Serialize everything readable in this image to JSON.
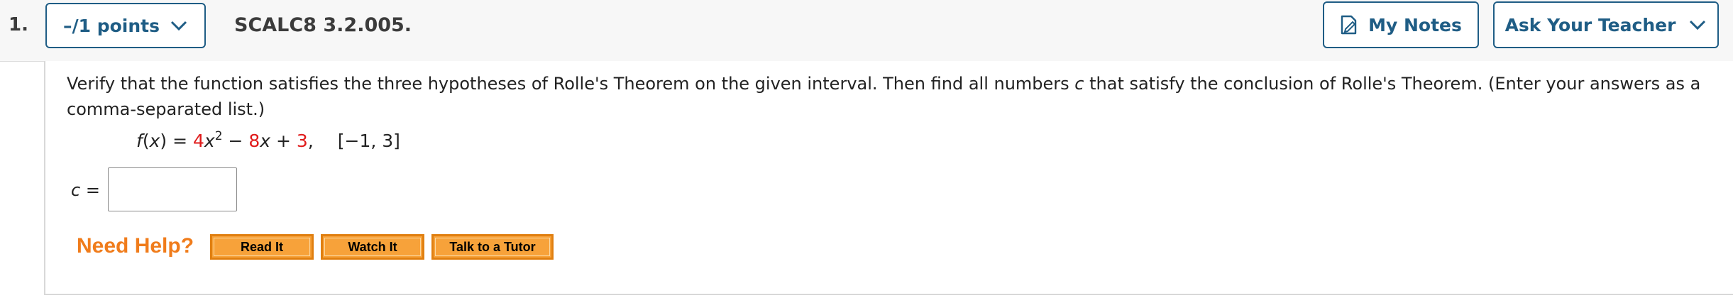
{
  "header": {
    "question_number": "1.",
    "points_label": "–/1 points",
    "question_id": "SCALC8 3.2.005.",
    "my_notes_label": "My Notes",
    "ask_teacher_label": "Ask Your Teacher"
  },
  "question": {
    "prompt_part1": "Verify that the function satisfies the three hypotheses of Rolle's Theorem on the given interval. Then find all numbers ",
    "prompt_var": "c",
    "prompt_part2": " that satisfy the conclusion of Rolle's Theorem. (Enter your answers as a comma-separated list.)",
    "formula": {
      "fname": "f",
      "open": "(",
      "var": "x",
      "close_eq": ") = ",
      "coef1": "4",
      "var2": "x",
      "exp": "2",
      "minus": " − ",
      "coef2": "8",
      "var3": "x",
      "plus": " + ",
      "const": "3",
      "comma": ",",
      "interval": "[−1, 3]"
    },
    "answer_var": "c",
    "answer_eq": " =",
    "answer_value": ""
  },
  "help": {
    "title": "Need Help?",
    "read_label": "Read It",
    "watch_label": "Watch It",
    "tutor_label": "Talk to a Tutor"
  },
  "colors": {
    "accent": "#1f5d85",
    "highlight_red": "#e01b1b",
    "help_orange": "#f07c1b",
    "button_orange": "#f7a23a"
  },
  "icons": {
    "points_chevron": "chevron-down-icon",
    "notes": "note-pencil-icon",
    "ask_chevron": "chevron-down-icon"
  }
}
